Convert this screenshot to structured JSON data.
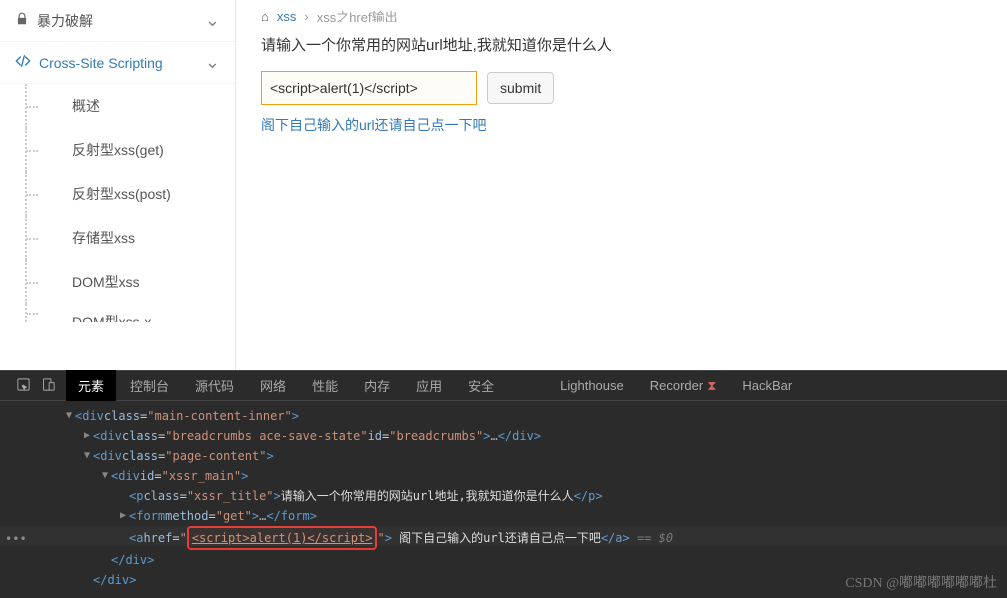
{
  "sidebar": {
    "collapsed": {
      "label": "暴力破解"
    },
    "active": {
      "label": "Cross-Site Scripting"
    },
    "subs": [
      "概述",
      "反射型xss(get)",
      "反射型xss(post)",
      "存储型xss",
      "DOM型xss",
      "DOM型xss-x"
    ]
  },
  "breadcrumb": {
    "a": "xss",
    "b": "xss之href输出"
  },
  "main": {
    "prompt": "请输入一个你常用的网站url地址,我就知道你是什么人",
    "input_value": "<script>alert(1)</script>",
    "submit": "submit",
    "result_link": "阁下自己输入的url还请自己点一下吧"
  },
  "devtools": {
    "tabs": [
      "元素",
      "控制台",
      "源代码",
      "网络",
      "性能",
      "内存",
      "应用",
      "安全",
      "Lighthouse",
      "Recorder",
      "HackBar"
    ],
    "code": {
      "l1_class": "main-content-inner",
      "l2_class": "breadcrumbs ace-save-state",
      "l2_id": "breadcrumbs",
      "l3_class": "page-content",
      "l4_id": "xssr_main",
      "l5_class": "xssr_title",
      "l5_text": "请输入一个你常用的网站url地址,我就知道你是什么人",
      "l6_method": "get",
      "l7_href": "<script>alert(1)</script>",
      "l7_text": " 阁下自己输入的url还请自己点一下吧",
      "ghost": " == $0"
    }
  },
  "watermark": "CSDN @嘟嘟嘟嘟嘟嘟杜"
}
